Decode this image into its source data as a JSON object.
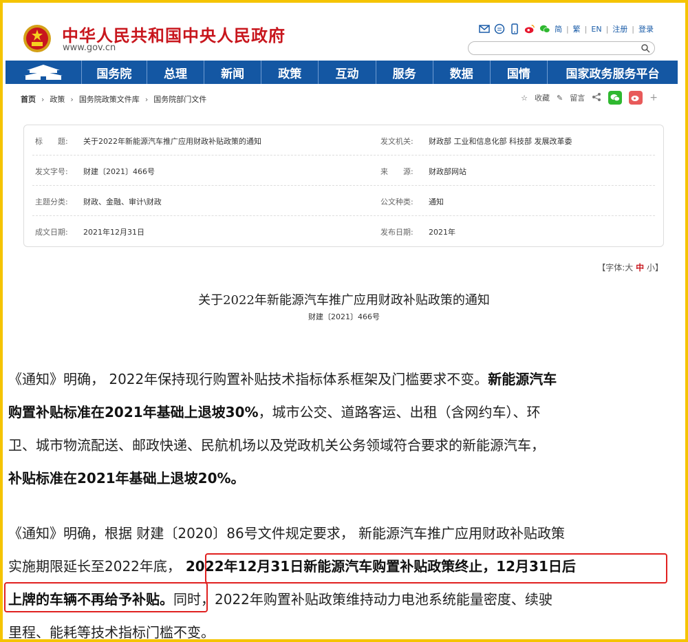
{
  "header": {
    "site_title": "中华人民共和国中央人民政府",
    "site_url": "www.gov.cn",
    "tools": {
      "simplified": "简",
      "traditional": "繁",
      "english": "EN",
      "register": "注册",
      "login": "登录"
    }
  },
  "nav": {
    "items": [
      "国务院",
      "总理",
      "新闻",
      "政策",
      "互动",
      "服务",
      "数据",
      "国情",
      "国家政务服务平台"
    ]
  },
  "breadcrumb": [
    "首页",
    "政策",
    "国务院政策文件库",
    "国务院部门文件"
  ],
  "actions": {
    "favorite": "收藏",
    "comment": "留言"
  },
  "info": {
    "title_label": "标　　题:",
    "title_value": "关于2022年新能源汽车推广应用财政补贴政策的通知",
    "issuer_label": "发文机关:",
    "issuer_value": "财政部  工业和信息化部  科技部  发展改革委",
    "docno_label": "发文字号:",
    "docno_value": "财建〔2021〕466号",
    "source_label": "来　　源:",
    "source_value": "财政部网站",
    "topic_label": "主题分类:",
    "topic_value": "财政、金融、审计\\财政",
    "type_label": "公文种类:",
    "type_value": "通知",
    "written_label": "成文日期:",
    "written_value": "2021年12月31日",
    "published_label": "发布日期:",
    "published_value": "2021年"
  },
  "font_size": {
    "prefix": "【字体:",
    "large": "大",
    "medium": "中",
    "small": "小",
    "suffix": "】"
  },
  "document": {
    "title": "关于2022年新能源汽车推广应用财政补贴政策的通知",
    "number": "财建〔2021〕466号"
  },
  "paragraph1": {
    "l1_normal": "《通知》明确， 2022年保持现行购置补贴技术指标体系框架及门槛要求不变。",
    "l1_bold": "新能源汽车",
    "l2_bold": "购置补贴标准在2021年基础上退坡30%",
    "l2_normal": "，城市公交、道路客运、出租（含网约车）、环",
    "l3_normal": "卫、城市物流配送、邮政快递、民航机场以及党政机关公务领域符合要求的新能源汽车，",
    "l4_bold": "补贴标准在2021年基础上退坡20%。"
  },
  "paragraph2": {
    "l1_normal": "《通知》明确，根据 财建〔2020〕86号文件规定要求， 新能源汽车推广应用财政补贴政策",
    "l2_normal": "实施期限延长至2022年底，",
    "l2_bold": " 2022年12月31日新能源汽车购置补贴政策终止，12月31日后",
    "l3_bold": "上牌的车辆不再给予补贴。",
    "l3_normal": "同时，2022年购置补贴政策维持动力电池系统能量密度、续驶",
    "l4_normal": "里程、能耗等技术指标门槛不变。"
  },
  "colors": {
    "nav_blue": "#1457a3",
    "brand_red": "#c8161d",
    "frame_yellow": "#f5c400",
    "highlight_red": "#e0201f"
  }
}
